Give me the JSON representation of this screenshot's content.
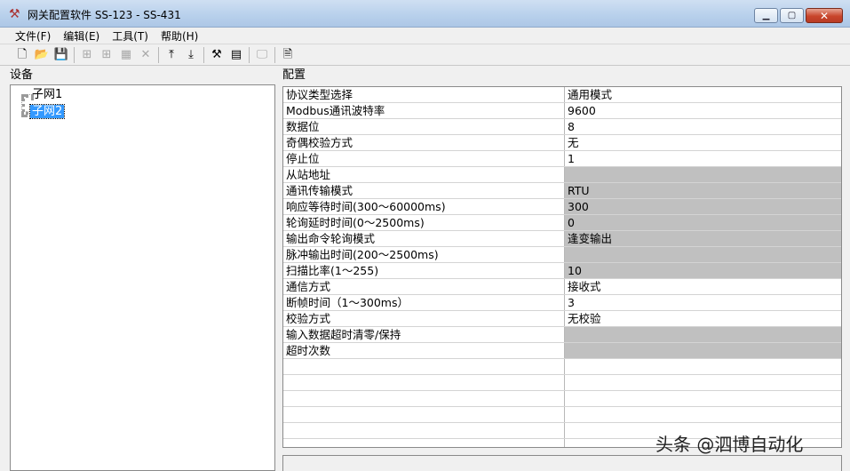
{
  "window": {
    "title": "网关配置软件 SS-123 - SS-431",
    "minimize_glyph": "▁",
    "maximize_glyph": "▢",
    "close_glyph": "✕"
  },
  "menu": [
    {
      "name": "menu-file",
      "label": "文件(F)"
    },
    {
      "name": "menu-edit",
      "label": "编辑(E)"
    },
    {
      "name": "menu-tools",
      "label": "工具(T)"
    },
    {
      "name": "menu-help",
      "label": "帮助(H)"
    }
  ],
  "toolbar": [
    {
      "name": "new-file-icon",
      "glyph": "🗋",
      "enabled": true
    },
    {
      "name": "open-folder-icon",
      "glyph": "📂",
      "enabled": true
    },
    {
      "name": "save-icon",
      "glyph": "💾",
      "enabled": true
    },
    {
      "sep": true
    },
    {
      "name": "add-subnet-icon",
      "glyph": "⊞",
      "enabled": false
    },
    {
      "name": "add-node-icon",
      "glyph": "⊞",
      "enabled": false
    },
    {
      "name": "properties-icon",
      "glyph": "▦",
      "enabled": false
    },
    {
      "name": "delete-icon",
      "glyph": "✕",
      "enabled": false
    },
    {
      "sep": true
    },
    {
      "name": "upload-icon",
      "glyph": "⤒",
      "enabled": true
    },
    {
      "name": "download-icon",
      "glyph": "⤓",
      "enabled": true
    },
    {
      "sep": true
    },
    {
      "name": "tools-icon",
      "glyph": "⚒",
      "enabled": true
    },
    {
      "name": "config-icon",
      "glyph": "▤",
      "enabled": true
    },
    {
      "sep": true
    },
    {
      "name": "monitor-icon",
      "glyph": "🖵",
      "enabled": false
    },
    {
      "sep": true
    },
    {
      "name": "document-icon",
      "glyph": "🗎",
      "enabled": true
    }
  ],
  "left_panel": {
    "title": "设备",
    "tree": [
      {
        "label": "子网1",
        "selected": false
      },
      {
        "label": "子网2",
        "selected": true
      }
    ]
  },
  "right_panel": {
    "title": "配置",
    "rows": [
      {
        "name": "协议类型选择",
        "value": "通用模式",
        "disabled": false
      },
      {
        "name": "Modbus通讯波特率",
        "value": "9600",
        "disabled": false
      },
      {
        "name": "数据位",
        "value": "8",
        "disabled": false
      },
      {
        "name": "奇偶校验方式",
        "value": "无",
        "disabled": false
      },
      {
        "name": "停止位",
        "value": "1",
        "disabled": false
      },
      {
        "name": "从站地址",
        "value": "",
        "disabled": true
      },
      {
        "name": "通讯传输模式",
        "value": "RTU",
        "disabled": true
      },
      {
        "name": "响应等待时间(300～60000ms)",
        "value": "300",
        "disabled": true
      },
      {
        "name": "轮询延时时间(0～2500ms)",
        "value": "0",
        "disabled": true
      },
      {
        "name": "输出命令轮询模式",
        "value": "逢变输出",
        "disabled": true
      },
      {
        "name": "脉冲输出时间(200～2500ms)",
        "value": "",
        "disabled": true
      },
      {
        "name": "扫描比率(1～255)",
        "value": "10",
        "disabled": true
      },
      {
        "name": "通信方式",
        "value": "接收式",
        "disabled": false
      },
      {
        "name": "断帧时间（1～300ms）",
        "value": "3",
        "disabled": false
      },
      {
        "name": "校验方式",
        "value": "无校验",
        "disabled": false
      },
      {
        "name": "输入数据超时清零/保持",
        "value": "",
        "disabled": true
      },
      {
        "name": "超时次数",
        "value": "",
        "disabled": true
      },
      {
        "name": "",
        "value": "",
        "disabled": false
      },
      {
        "name": "",
        "value": "",
        "disabled": false
      },
      {
        "name": "",
        "value": "",
        "disabled": false
      },
      {
        "name": "",
        "value": "",
        "disabled": false
      },
      {
        "name": "",
        "value": "",
        "disabled": false
      },
      {
        "name": "",
        "value": "",
        "disabled": false
      }
    ]
  },
  "watermark": "头条 @泗博自动化"
}
